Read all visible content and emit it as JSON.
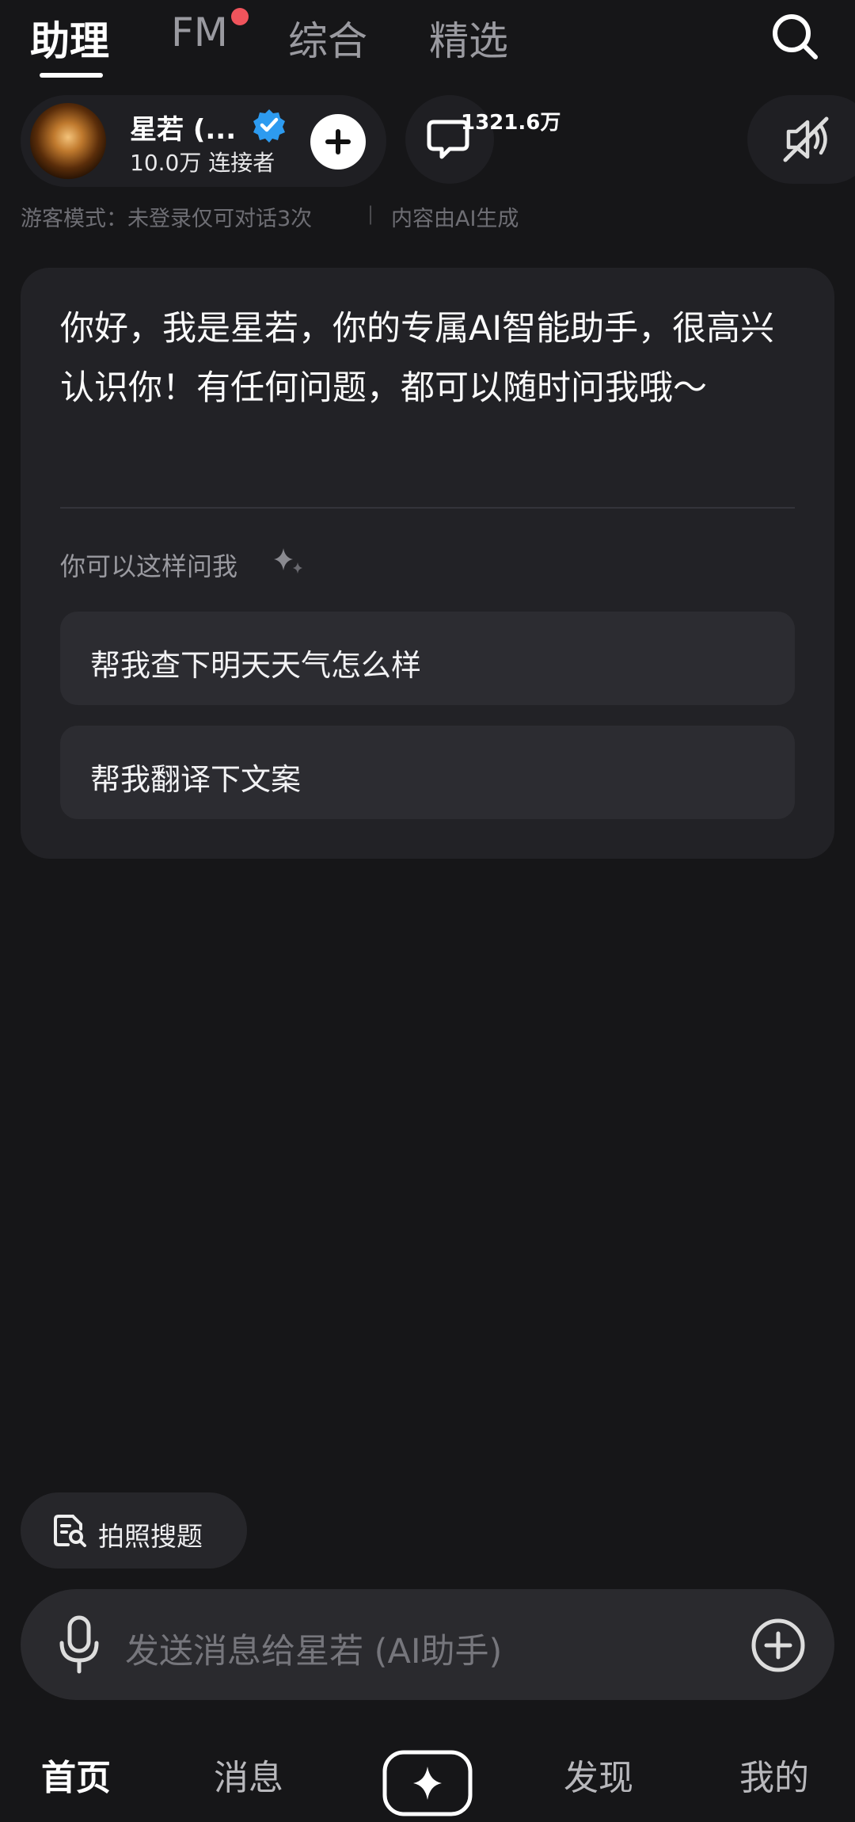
{
  "tabs": [
    {
      "label": "助理",
      "active": true
    },
    {
      "label": "FM",
      "active": false,
      "has_dot": true
    },
    {
      "label": "综合",
      "active": false
    },
    {
      "label": "精选",
      "active": false
    }
  ],
  "profile": {
    "name": "星若 (...",
    "connectors": "10.0万 连接者",
    "comment_count": "1321.6万"
  },
  "notice": {
    "guest_mode": "游客模式：未登录仅可对话3次",
    "separator": "|",
    "ai_generated": "内容由AI生成"
  },
  "card": {
    "greeting": "你好，我是星若，你的专属AI智能助手，很高兴认识你！有任何问题，都可以随时问我哦～",
    "suggest_label": "你可以这样问我",
    "suggestions": [
      "帮我查下明天天气怎么样",
      "帮我翻译下文案"
    ]
  },
  "photo_search": {
    "label": "拍照搜题"
  },
  "input": {
    "placeholder": "发送消息给星若 (AI助手)"
  },
  "bottom_nav": {
    "items": [
      "首页",
      "消息",
      "发现",
      "我的"
    ]
  },
  "colors": {
    "background": "#161618",
    "card": "#222226",
    "chip": "#2c2c31",
    "accent_dot": "#f0545c",
    "verified_blue": "#2d9bf0"
  },
  "icons": [
    "search-icon",
    "verified-icon",
    "plus-icon",
    "comment-icon",
    "mute-icon",
    "sparkle-icon",
    "photo-search-icon",
    "mic-icon",
    "add-circle-icon",
    "create-icon"
  ]
}
